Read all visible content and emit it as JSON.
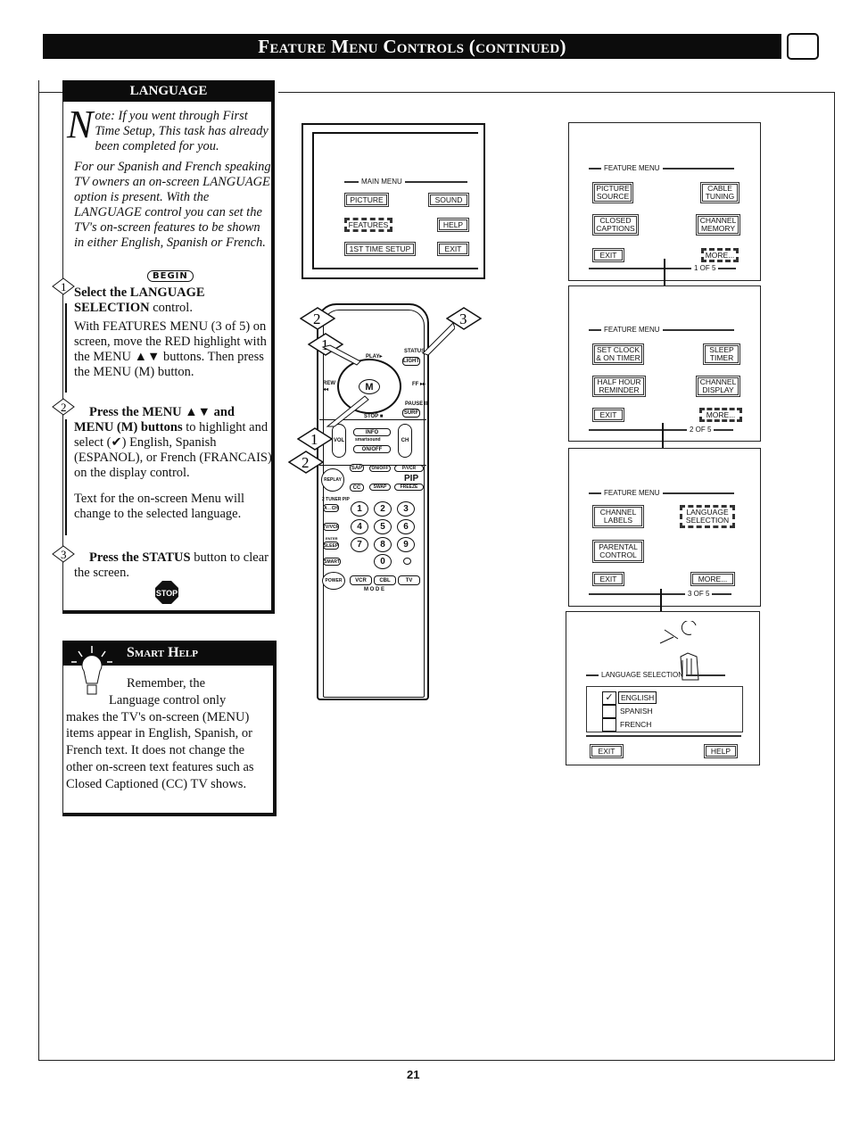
{
  "header": {
    "title": "Feature Menu Controls (continued)",
    "icon": "tv-icon"
  },
  "language": {
    "title": "LANGUAGE",
    "note_dropcap": "N",
    "note": "ote: If you went through First Time Setup, This task has already been completed for you.",
    "intro": "For our Spanish and French speaking TV owners an on-screen LANGUAGE option is present. With the LANGUAGE control you can set the TV's on-screen features to be shown in either English, Spanish or French.",
    "begin": "BEGIN",
    "steps": [
      {
        "num": "1",
        "bold": "Select the LANGUAGE SELECTION",
        "rest": " control.",
        "body": "With FEATURES MENU (3 of 5) on screen, move the RED highlight with the MENU ▲▼ buttons. Then press the MENU (M) button."
      },
      {
        "num": "2",
        "bold": "Press the MENU ▲▼ and MENU (M) buttons",
        "rest": " to highlight and select (✔) English, Spanish (ESPANOL), or French (FRANCAIS) on the display control.",
        "body": "Text for the on-screen Menu will change to the selected language."
      },
      {
        "num": "3",
        "bold": "Press the STATUS",
        "rest": " button to clear the screen.",
        "body": ""
      }
    ],
    "stop": "STOP"
  },
  "smart_help": {
    "title": "Smart Help",
    "text_line1": "Remember, the",
    "text_line2": "Language control only",
    "text_rest": "makes the TV's on-screen (MENU) items appear in English, Spanish, or French text. It does not change the other on-screen text features such as Closed Captioned (CC) TV shows."
  },
  "main_menu": {
    "title": "MAIN MENU",
    "items": [
      "PICTURE",
      "SOUND",
      "FEATURES",
      "HELP",
      "1ST TIME SETUP",
      "EXIT"
    ]
  },
  "remote": {
    "callouts": [
      "1",
      "2",
      "3",
      "1",
      "2"
    ],
    "labels": {
      "play": "PLAY▸",
      "status": "STATUS",
      "light": "LIGHT",
      "rew": "REW ◂◂",
      "ff": "FF ▸▸",
      "pause": "PAUSE II",
      "surf": "SURF",
      "stop": "STOP ■",
      "menu": "M",
      "ch_btn": "CH",
      "vol": "VOL",
      "info": "INFO",
      "smartsound": "smartsound",
      "onoff": "ON/OFF",
      "ch": "CH",
      "sap": "SAP",
      "replay": "REPLAY",
      "cc": "CC",
      "pip_onoff": "ON/OFF",
      "pvcr": "P/VCR",
      "pip": "PIP",
      "swap": "SWAP",
      "freeze": "FREEZE",
      "tuner": "2 TUNER PIP",
      "a_ch": "A↔CH",
      "tvvcr": "TV/VCR",
      "enter": "ENTER",
      "sleep": "SLEEP",
      "smart": "SMART",
      "power": "POWER",
      "vcr": "VCR",
      "cbl": "CBL",
      "tv": "TV",
      "mode": "M O D E"
    },
    "digits": [
      "1",
      "2",
      "3",
      "4",
      "5",
      "6",
      "7",
      "8",
      "9",
      "0"
    ]
  },
  "screens": [
    {
      "title": "FEATURE MENU",
      "items": [
        "PICTURE SOURCE",
        "CABLE TUNING",
        "CLOSED CAPTIONS",
        "CHANNEL MEMORY",
        "EXIT",
        "MORE..."
      ],
      "page": "1 OF 5"
    },
    {
      "title": "FEATURE MENU",
      "items": [
        "SET CLOCK & ON TIMER",
        "SLEEP TIMER",
        "HALF HOUR REMINDER",
        "CHANNEL DISPLAY",
        "EXIT",
        "MORE..."
      ],
      "page": "2 OF 5"
    },
    {
      "title": "FEATURE MENU",
      "items": [
        "CHANNEL LABELS",
        "LANGUAGE SELECTION",
        "PARENTAL CONTROL",
        "EXIT",
        "MORE..."
      ],
      "page": "3 OF 5"
    },
    {
      "title": "LANGUAGE SELECTION",
      "options": [
        {
          "label": "ENGLISH",
          "checked": true
        },
        {
          "label": "SPANISH",
          "checked": false
        },
        {
          "label": "FRENCH",
          "checked": false
        }
      ],
      "exit": "EXIT",
      "help": "HELP"
    }
  ],
  "page_number": "21"
}
